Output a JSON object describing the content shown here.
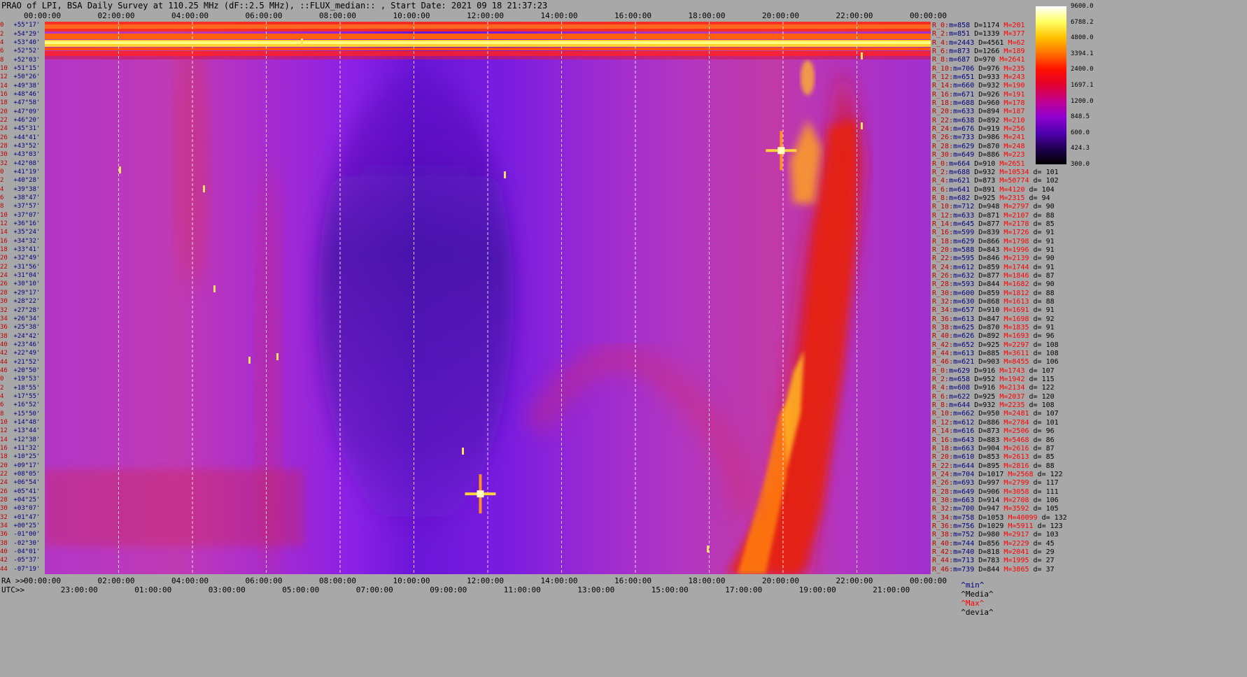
{
  "title": "PRAO of LPI, BSA Daily Survey at 110.25 MHz (dF::2.5 MHz), ::FLUX_median:: , Start Date: 2021 09 18 21:37:23",
  "top_axis": [
    "00:00:00",
    "02:00:00",
    "04:00:00",
    "06:00:00",
    "08:00:00",
    "10:00:00",
    "12:00:00",
    "14:00:00",
    "16:00:00",
    "18:00:00",
    "20:00:00",
    "22:00:00",
    "00:00:00"
  ],
  "ra_prefix": "RA >>",
  "ra_axis": [
    "00:00:00",
    "02:00:00",
    "04:00:00",
    "06:00:00",
    "08:00:00",
    "10:00:00",
    "12:00:00",
    "14:00:00",
    "16:00:00",
    "18:00:00",
    "20:00:00",
    "22:00:00",
    "00:00:00"
  ],
  "utc_prefix": "UTC>>",
  "utc_axis": [
    "23:00:00",
    "01:00:00",
    "03:00:00",
    "05:00:00",
    "07:00:00",
    "09:00:00",
    "11:00:00",
    "13:00:00",
    "15:00:00",
    "17:00:00",
    "19:00:00",
    "21:00:00"
  ],
  "colorbar": {
    "ticks": [
      "9600.0",
      "6788.2",
      "4800.0",
      "3394.1",
      "2400.0",
      "1697.1",
      "1200.0",
      "848.5",
      "600.0",
      "424.3",
      "300.0"
    ],
    "colors": [
      "#ffffff",
      "#ffff60",
      "#ffc000",
      "#ff7000",
      "#ff1000",
      "#e00030",
      "#c00090",
      "#9000d0",
      "#5000b0",
      "#200050",
      "#000000"
    ]
  },
  "declinations": [
    {
      "i": "0",
      "d": "+55°17'"
    },
    {
      "i": "2",
      "d": "+54°29'"
    },
    {
      "i": "4",
      "d": "+53°40'"
    },
    {
      "i": "6",
      "d": "+52°52'"
    },
    {
      "i": "8",
      "d": "+52°03'"
    },
    {
      "i": "10",
      "d": "+51°15'"
    },
    {
      "i": "12",
      "d": "+50°26'"
    },
    {
      "i": "14",
      "d": "+49°38'"
    },
    {
      "i": "16",
      "d": "+48°46'"
    },
    {
      "i": "18",
      "d": "+47°58'"
    },
    {
      "i": "20",
      "d": "+47°09'"
    },
    {
      "i": "22",
      "d": "+46°20'"
    },
    {
      "i": "24",
      "d": "+45°31'"
    },
    {
      "i": "26",
      "d": "+44°41'"
    },
    {
      "i": "28",
      "d": "+43°52'"
    },
    {
      "i": "30",
      "d": "+43°03'"
    },
    {
      "i": "32",
      "d": "+42°08'"
    },
    {
      "i": "0",
      "d": "+41°19'"
    },
    {
      "i": "2",
      "d": "+40°28'"
    },
    {
      "i": "4",
      "d": "+39°38'"
    },
    {
      "i": "6",
      "d": "+38°47'"
    },
    {
      "i": "8",
      "d": "+37°57'"
    },
    {
      "i": "10",
      "d": "+37°07'"
    },
    {
      "i": "12",
      "d": "+36°16'"
    },
    {
      "i": "14",
      "d": "+35°24'"
    },
    {
      "i": "16",
      "d": "+34°32'"
    },
    {
      "i": "18",
      "d": "+33°41'"
    },
    {
      "i": "20",
      "d": "+32°49'"
    },
    {
      "i": "22",
      "d": "+31°56'"
    },
    {
      "i": "24",
      "d": "+31°04'"
    },
    {
      "i": "26",
      "d": "+30°10'"
    },
    {
      "i": "28",
      "d": "+29°17'"
    },
    {
      "i": "30",
      "d": "+28°22'"
    },
    {
      "i": "32",
      "d": "+27°28'"
    },
    {
      "i": "34",
      "d": "+26°34'"
    },
    {
      "i": "36",
      "d": "+25°38'"
    },
    {
      "i": "38",
      "d": "+24°42'"
    },
    {
      "i": "40",
      "d": "+23°46'"
    },
    {
      "i": "42",
      "d": "+22°49'"
    },
    {
      "i": "44",
      "d": "+21°52'"
    },
    {
      "i": "46",
      "d": "+20°50'"
    },
    {
      "i": "0",
      "d": "+19°53'"
    },
    {
      "i": "2",
      "d": "+18°55'"
    },
    {
      "i": "4",
      "d": "+17°55'"
    },
    {
      "i": "6",
      "d": "+16°52'"
    },
    {
      "i": "8",
      "d": "+15°50'"
    },
    {
      "i": "10",
      "d": "+14°48'"
    },
    {
      "i": "12",
      "d": "+13°44'"
    },
    {
      "i": "14",
      "d": "+12°38'"
    },
    {
      "i": "16",
      "d": "+11°32'"
    },
    {
      "i": "18",
      "d": "+10°25'"
    },
    {
      "i": "20",
      "d": "+09°17'"
    },
    {
      "i": "22",
      "d": "+08°05'"
    },
    {
      "i": "24",
      "d": "+06°54'"
    },
    {
      "i": "26",
      "d": "+05°41'"
    },
    {
      "i": "28",
      "d": "+04°25'"
    },
    {
      "i": "30",
      "d": "+03°07'"
    },
    {
      "i": "32",
      "d": "+01°47'"
    },
    {
      "i": "34",
      "d": "+00°25'"
    },
    {
      "i": "36",
      "d": "-01°00'"
    },
    {
      "i": "38",
      "d": "-02°30'"
    },
    {
      "i": "40",
      "d": "-04°01'"
    },
    {
      "i": "42",
      "d": "-05°37'"
    },
    {
      "i": "44",
      "d": "-07°19'"
    }
  ],
  "stats": [
    {
      "r": "R_0:",
      "m": "858",
      "D": "1174",
      "M": "201",
      "d": ""
    },
    {
      "r": "R_2:",
      "m": "851",
      "D": "1339",
      "M": "377",
      "d": ""
    },
    {
      "r": "R_4:",
      "m": "2443",
      "D": "4561",
      "M": "62",
      "d": ""
    },
    {
      "r": "R_6:",
      "m": "873",
      "D": "1266",
      "M": "189",
      "d": ""
    },
    {
      "r": "R_8:",
      "m": "687",
      "D": "970",
      "M": "2641",
      "d": ""
    },
    {
      "r": "R_10:",
      "m": "706",
      "D": "976",
      "M": "235",
      "d": ""
    },
    {
      "r": "R_12:",
      "m": "651",
      "D": "933",
      "M": "243",
      "d": ""
    },
    {
      "r": "R_14:",
      "m": "660",
      "D": "932",
      "M": "190",
      "d": ""
    },
    {
      "r": "R_16:",
      "m": "671",
      "D": "926",
      "M": "191",
      "d": ""
    },
    {
      "r": "R_18:",
      "m": "688",
      "D": "960",
      "M": "178",
      "d": ""
    },
    {
      "r": "R_20:",
      "m": "633",
      "D": "894",
      "M": "187",
      "d": ""
    },
    {
      "r": "R_22:",
      "m": "638",
      "D": "892",
      "M": "210",
      "d": ""
    },
    {
      "r": "R_24:",
      "m": "676",
      "D": "919",
      "M": "256",
      "d": ""
    },
    {
      "r": "R_26:",
      "m": "733",
      "D": "986",
      "M": "241",
      "d": ""
    },
    {
      "r": "R_28:",
      "m": "629",
      "D": "870",
      "M": "248",
      "d": ""
    },
    {
      "r": "R_30:",
      "m": "649",
      "D": "886",
      "M": "223",
      "d": ""
    },
    {
      "r": "R_0:",
      "m": "664",
      "D": "910",
      "M": "2651",
      "d": ""
    },
    {
      "r": "R_2:",
      "m": "688",
      "D": "932",
      "M": "10534",
      "d": "101"
    },
    {
      "r": "R_4:",
      "m": "621",
      "D": "873",
      "M": "50774",
      "d": "102"
    },
    {
      "r": "R_6:",
      "m": "641",
      "D": "891",
      "M": "4120",
      "d": "104"
    },
    {
      "r": "R_8:",
      "m": "682",
      "D": "925",
      "M": "2315",
      "d": "94"
    },
    {
      "r": "R_10:",
      "m": "712",
      "D": "948",
      "M": "2797",
      "d": "90"
    },
    {
      "r": "R_12:",
      "m": "633",
      "D": "871",
      "M": "2107",
      "d": "88"
    },
    {
      "r": "R_14:",
      "m": "645",
      "D": "877",
      "M": "2178",
      "d": "85"
    },
    {
      "r": "R_16:",
      "m": "599",
      "D": "839",
      "M": "1726",
      "d": "91"
    },
    {
      "r": "R_18:",
      "m": "629",
      "D": "866",
      "M": "1798",
      "d": "91"
    },
    {
      "r": "R_20:",
      "m": "588",
      "D": "843",
      "M": "1996",
      "d": "91"
    },
    {
      "r": "R_22:",
      "m": "595",
      "D": "846",
      "M": "2139",
      "d": "90"
    },
    {
      "r": "R_24:",
      "m": "612",
      "D": "859",
      "M": "1744",
      "d": "91"
    },
    {
      "r": "R_26:",
      "m": "632",
      "D": "877",
      "M": "1846",
      "d": "87"
    },
    {
      "r": "R_28:",
      "m": "593",
      "D": "844",
      "M": "1682",
      "d": "90"
    },
    {
      "r": "R_30:",
      "m": "600",
      "D": "859",
      "M": "1812",
      "d": "88"
    },
    {
      "r": "R_32:",
      "m": "630",
      "D": "868",
      "M": "1613",
      "d": "88"
    },
    {
      "r": "R_34:",
      "m": "657",
      "D": "910",
      "M": "1691",
      "d": "91"
    },
    {
      "r": "R_36:",
      "m": "613",
      "D": "847",
      "M": "1698",
      "d": "92"
    },
    {
      "r": "R_38:",
      "m": "625",
      "D": "870",
      "M": "1835",
      "d": "91"
    },
    {
      "r": "R_40:",
      "m": "626",
      "D": "892",
      "M": "1693",
      "d": "96"
    },
    {
      "r": "R_42:",
      "m": "652",
      "D": "925",
      "M": "2297",
      "d": "108"
    },
    {
      "r": "R_44:",
      "m": "613",
      "D": "885",
      "M": "3611",
      "d": "108"
    },
    {
      "r": "R_46:",
      "m": "621",
      "D": "903",
      "M": "8455",
      "d": "106"
    },
    {
      "r": "R_0:",
      "m": "629",
      "D": "916",
      "M": "1743",
      "d": "107"
    },
    {
      "r": "R_2:",
      "m": "658",
      "D": "952",
      "M": "1942",
      "d": "115"
    },
    {
      "r": "R_4:",
      "m": "608",
      "D": "916",
      "M": "2134",
      "d": "122"
    },
    {
      "r": "R_6:",
      "m": "622",
      "D": "925",
      "M": "2037",
      "d": "120"
    },
    {
      "r": "R_8:",
      "m": "644",
      "D": "932",
      "M": "2235",
      "d": "108"
    },
    {
      "r": "R_10:",
      "m": "662",
      "D": "950",
      "M": "2481",
      "d": "107"
    },
    {
      "r": "R_12:",
      "m": "612",
      "D": "886",
      "M": "2784",
      "d": "101"
    },
    {
      "r": "R_14:",
      "m": "616",
      "D": "873",
      "M": "2506",
      "d": "96"
    },
    {
      "r": "R_16:",
      "m": "643",
      "D": "883",
      "M": "5468",
      "d": "86"
    },
    {
      "r": "R_18:",
      "m": "663",
      "D": "904",
      "M": "2616",
      "d": "87"
    },
    {
      "r": "R_20:",
      "m": "610",
      "D": "853",
      "M": "2613",
      "d": "85"
    },
    {
      "r": "R_22:",
      "m": "644",
      "D": "895",
      "M": "2816",
      "d": "88"
    },
    {
      "r": "R_24:",
      "m": "704",
      "D": "1017",
      "M": "2568",
      "d": "122"
    },
    {
      "r": "R_26:",
      "m": "693",
      "D": "997",
      "M": "2799",
      "d": "117"
    },
    {
      "r": "R_28:",
      "m": "649",
      "D": "906",
      "M": "3058",
      "d": "111"
    },
    {
      "r": "R_30:",
      "m": "663",
      "D": "914",
      "M": "2708",
      "d": "106"
    },
    {
      "r": "R_32:",
      "m": "700",
      "D": "947",
      "M": "3592",
      "d": "105"
    },
    {
      "r": "R_34:",
      "m": "758",
      "D": "1053",
      "M": "40099",
      "d": "132"
    },
    {
      "r": "R_36:",
      "m": "756",
      "D": "1029",
      "M": "5911",
      "d": "123"
    },
    {
      "r": "R_38:",
      "m": "752",
      "D": "980",
      "M": "2917",
      "d": "103"
    },
    {
      "r": "R_40:",
      "m": "744",
      "D": "856",
      "M": "2229",
      "d": "45"
    },
    {
      "r": "R_42:",
      "m": "740",
      "D": "818",
      "M": "2041",
      "d": "29"
    },
    {
      "r": "R_44:",
      "m": "713",
      "D": "783",
      "M": "1995",
      "d": "27"
    },
    {
      "r": "R_46:",
      "m": "739",
      "D": "844",
      "M": "3865",
      "d": "37"
    }
  ],
  "legend": {
    "min": "^min^",
    "media": "^Media^",
    "max": "^Max^",
    "devia": "^devia^"
  },
  "chart_data": {
    "type": "heatmap",
    "title": "PRAO of LPI, BSA Daily Survey at 110.25 MHz (dF::2.5 MHz), ::FLUX_median:: , Start Date: 2021 09 18 21:37:23",
    "x_axis_top": "00:00:00 to 00:00:00 (2 h ticks)",
    "x_range_hours": [
      0,
      24
    ],
    "y_range_dec_deg": [
      -7.3,
      55.3
    ],
    "color_scale": "log",
    "color_range": [
      300,
      9600
    ],
    "features": [
      {
        "name": "galactic plane ridge",
        "ra_start_h": 17.3,
        "ra_end_h": 20.3,
        "dec_start_deg": -7.3,
        "dec_end_deg": 47.0
      },
      {
        "name": "cold region",
        "ra_start_h": 8.0,
        "ra_end_h": 14.0
      },
      {
        "name": "source",
        "ra_h": 19.95,
        "dec_deg": 40.7
      },
      {
        "name": "source",
        "ra_h": 11.8,
        "dec_deg": 1.8
      }
    ]
  }
}
